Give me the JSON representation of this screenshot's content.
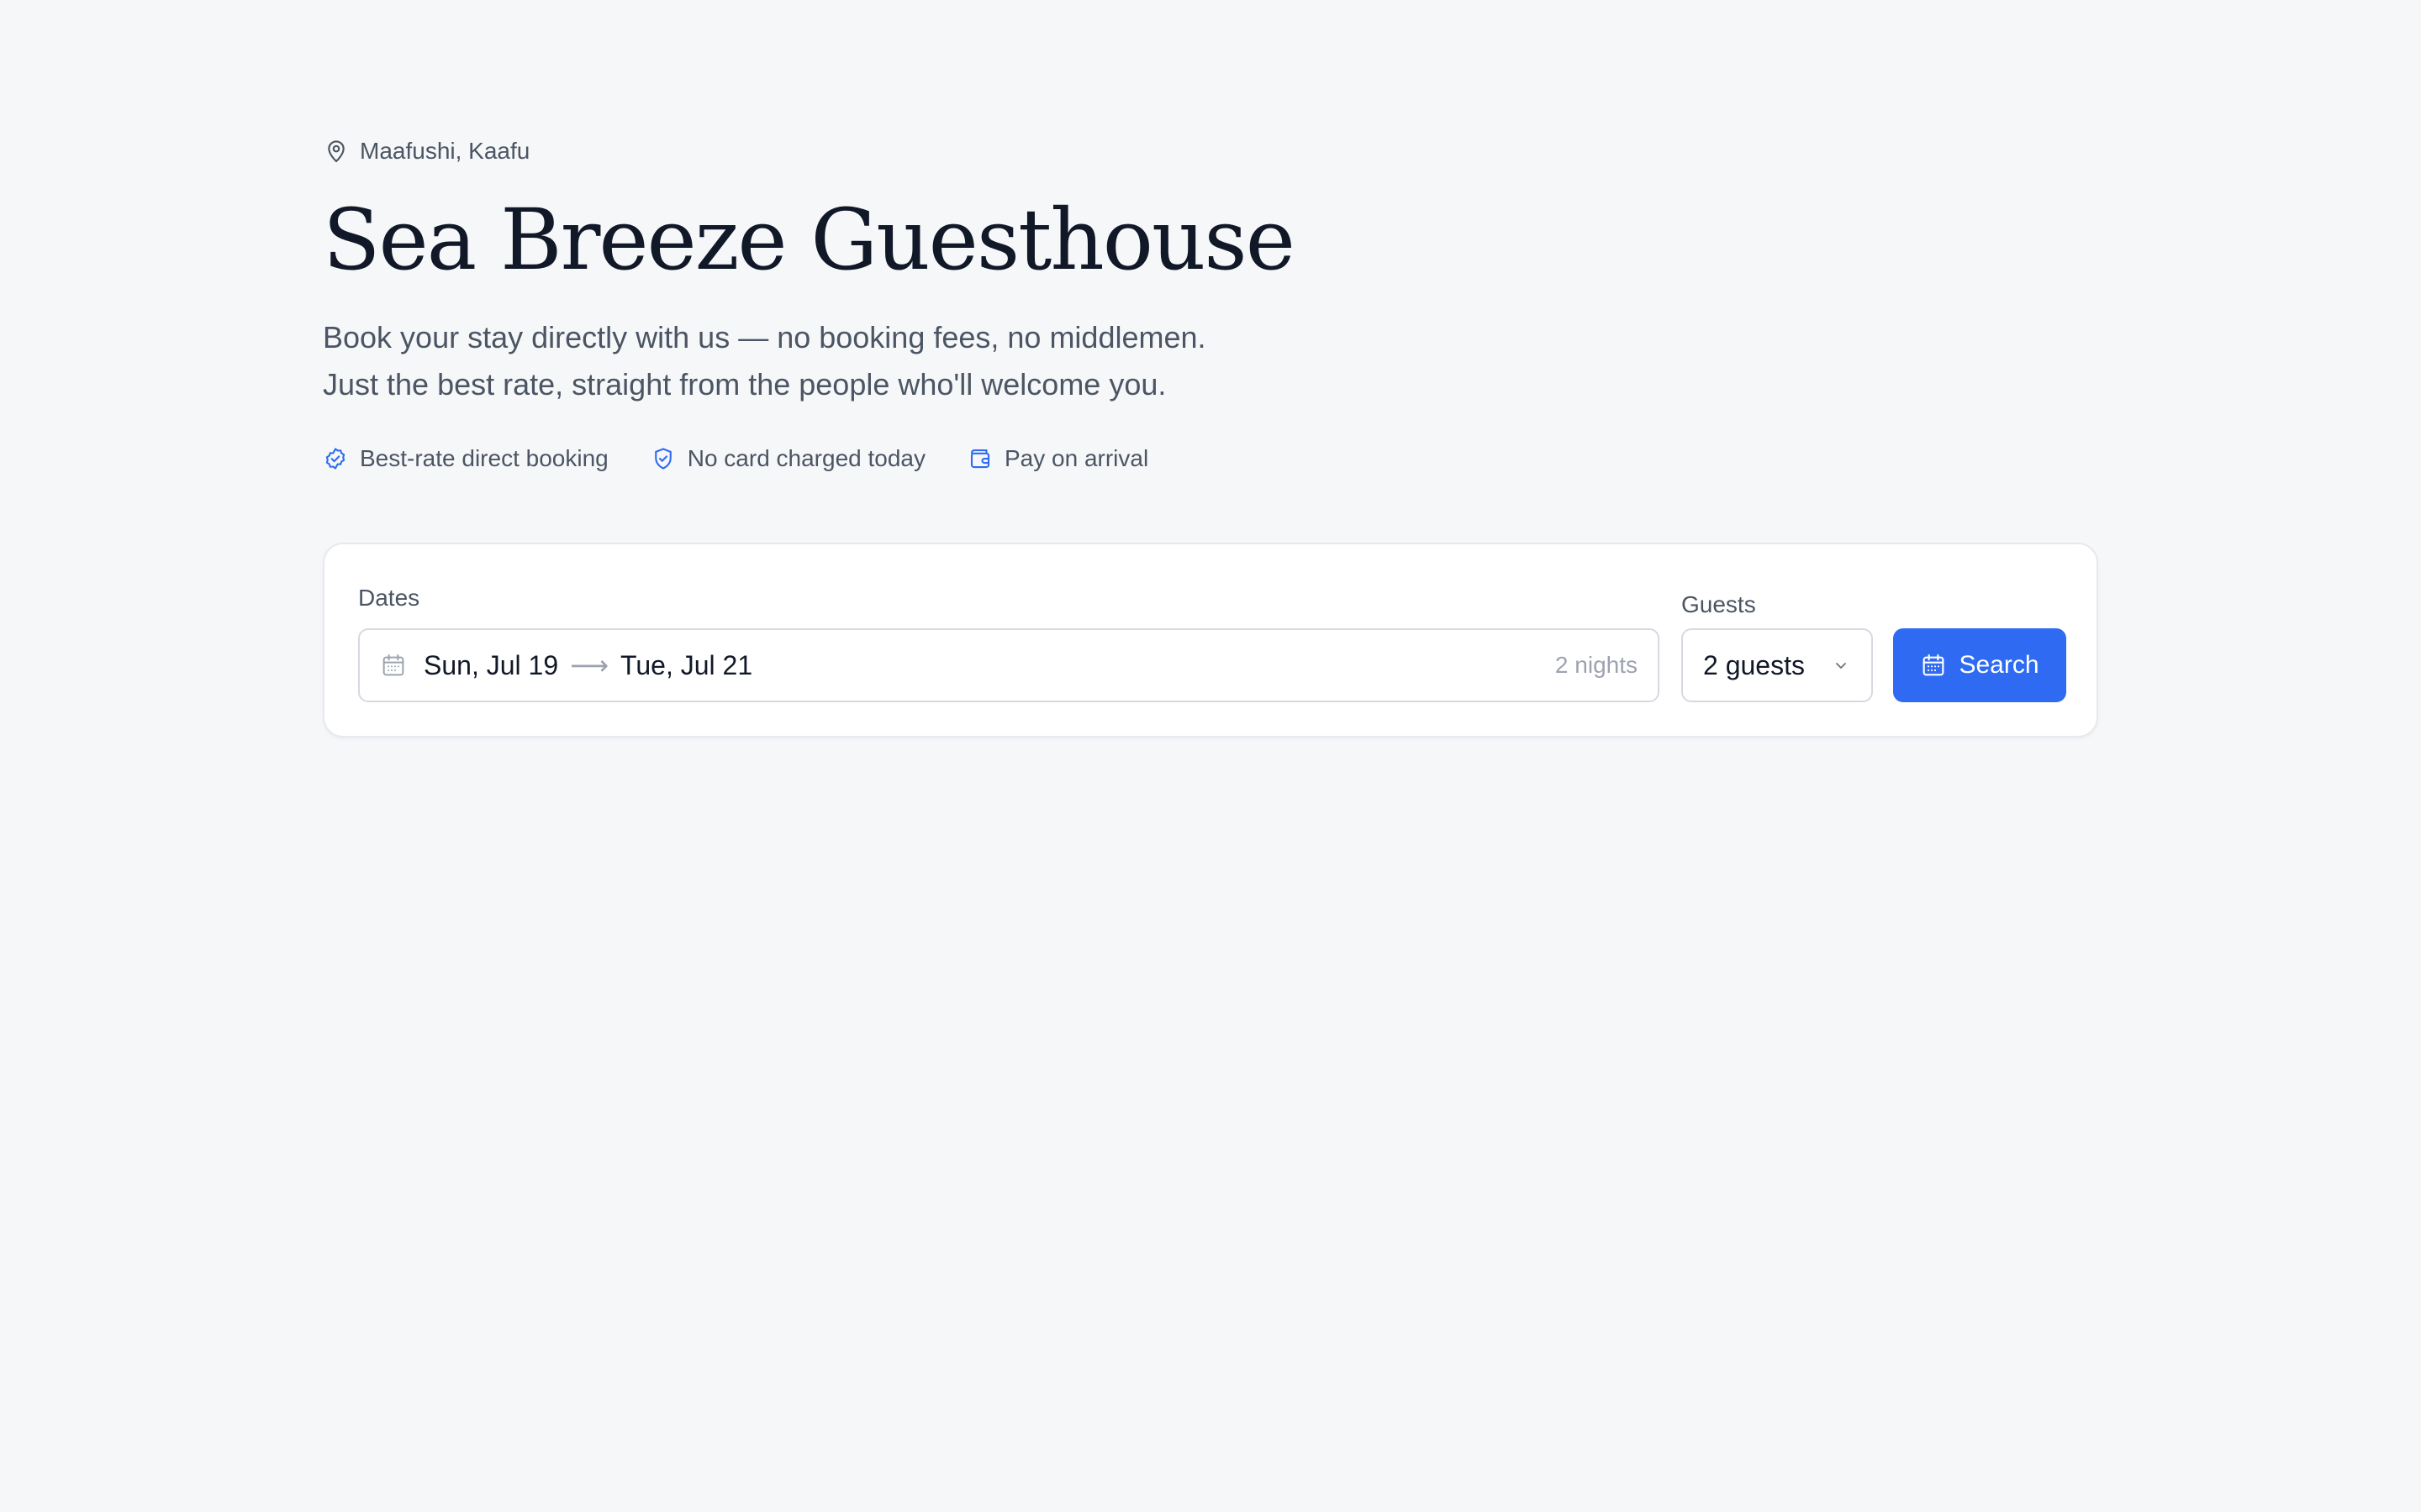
{
  "location": "Maafushi, Kaafu",
  "title": "Sea Breeze Guesthouse",
  "subtitle": {
    "line1": "Book your stay directly with us — no booking fees, no middlemen.",
    "line2": "Just the best rate, straight from the people who'll welcome you."
  },
  "perks": [
    {
      "label": "Best-rate direct booking",
      "icon": "check-circle-icon"
    },
    {
      "label": "No card charged today",
      "icon": "shield-check-icon"
    },
    {
      "label": "Pay on arrival",
      "icon": "wallet-icon"
    }
  ],
  "booking": {
    "dates_label": "Dates",
    "check_in": "Sun, Jul 19",
    "arrow": "⟶",
    "check_out": "Tue, Jul 21",
    "nights": "2 nights",
    "guests_label": "Guests",
    "guests_value": "2 guests",
    "search_label": "Search"
  },
  "colors": {
    "accent": "#2f6bf2",
    "background": "#f6f7f9",
    "text_muted": "#4b5563"
  }
}
